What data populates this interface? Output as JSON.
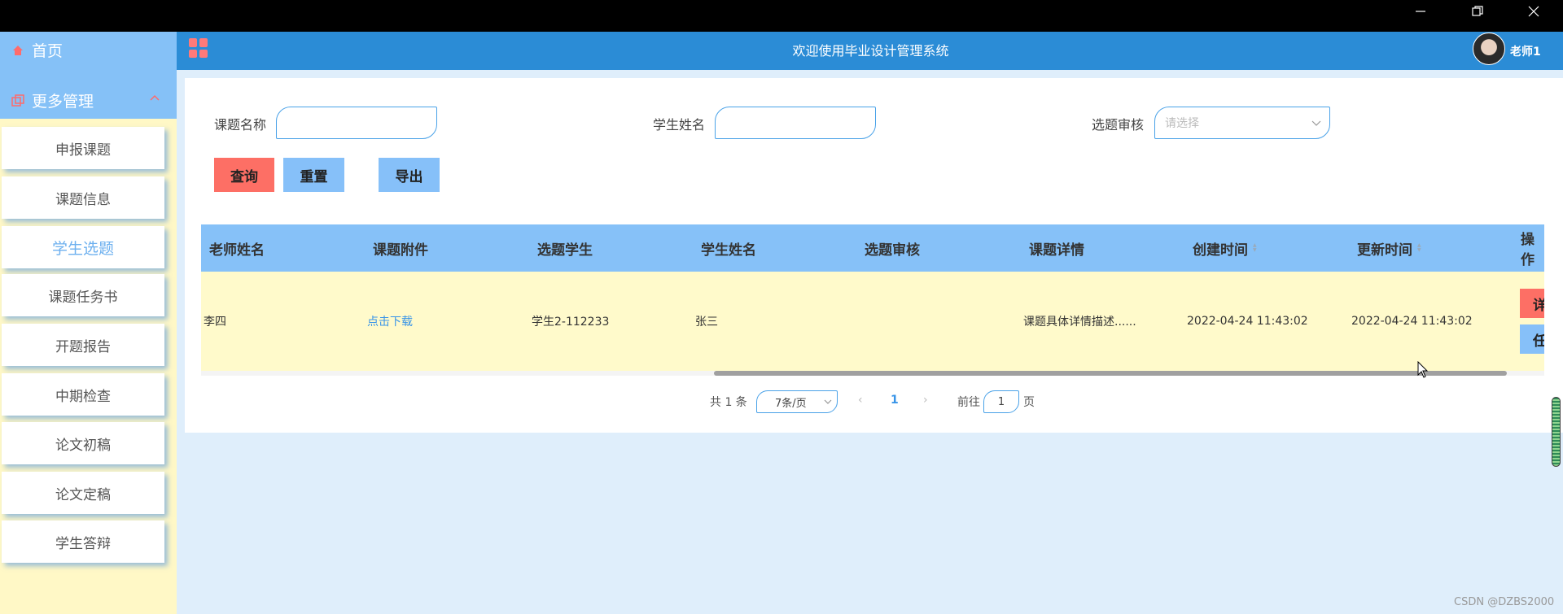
{
  "window": {
    "minimize_icon": "minimize-icon",
    "maximize_icon": "restore-icon",
    "close_icon": "close-icon"
  },
  "sidebar": {
    "home": {
      "label": "首页",
      "icon": "home-icon"
    },
    "more": {
      "label": "更多管理",
      "icon": "copy-icon"
    },
    "items": [
      {
        "label": "申报课题"
      },
      {
        "label": "课题信息"
      },
      {
        "label": "学生选题",
        "active": true
      },
      {
        "label": "课题任务书"
      },
      {
        "label": "开题报告"
      },
      {
        "label": "中期检查"
      },
      {
        "label": "论文初稿"
      },
      {
        "label": "论文定稿"
      },
      {
        "label": "学生答辩"
      }
    ]
  },
  "header": {
    "title": "欢迎使用毕业设计管理系统",
    "user": "老师1"
  },
  "filters": {
    "topic_label": "课题名称",
    "topic_value": "",
    "student_label": "学生姓名",
    "student_value": "",
    "review_label": "选题审核",
    "review_placeholder": "请选择"
  },
  "buttons": {
    "search": "查询",
    "reset": "重置",
    "export": "导出"
  },
  "table": {
    "headers": [
      "老师姓名",
      "课题附件",
      "选题学生",
      "学生姓名",
      "选题审核",
      "课题详情",
      "创建时间",
      "更新时间",
      "操作"
    ],
    "rows": [
      {
        "teacher": "李四",
        "attachment": "点击下载",
        "student_account": "学生2-112233",
        "student_name": "张三",
        "review": "",
        "detail": "课题具体详情描述......",
        "created": "2022-04-24 11:43:02",
        "updated": "2022-04-24 11:43:02",
        "op1": "详",
        "op2": "任"
      }
    ]
  },
  "pagination": {
    "total": "共 1 条",
    "page_size": "7条/页",
    "current": "1",
    "goto_label": "前往",
    "goto_value": "1",
    "page_suffix": "页"
  },
  "colors": {
    "header": "#2b8cd6",
    "table_header": "#86c1f8",
    "row_bg": "#fffacb",
    "search_btn": "#fd6f65",
    "sidebar_bg": "#fff8c6"
  },
  "watermark": "CSDN @DZBS2000"
}
